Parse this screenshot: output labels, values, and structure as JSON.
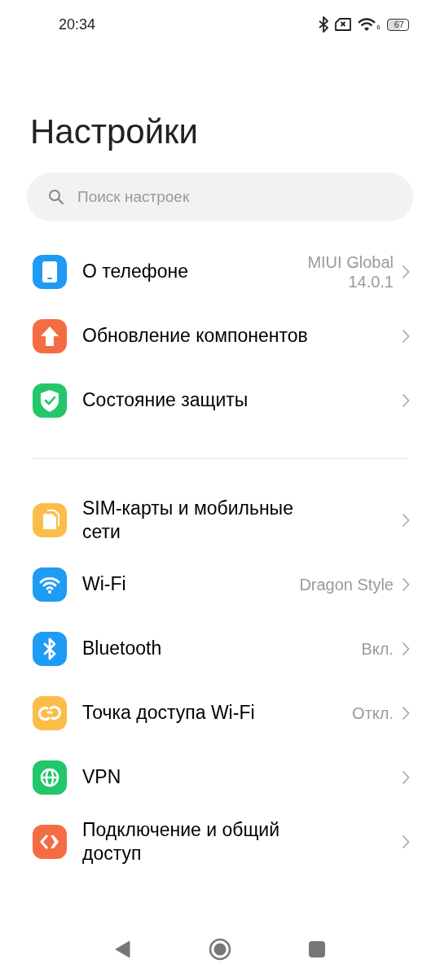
{
  "status_bar": {
    "time": "20:34",
    "wifi_badge": "6",
    "battery": "67"
  },
  "title": "Настройки",
  "search": {
    "placeholder": "Поиск настроек"
  },
  "groups": [
    {
      "items": [
        {
          "label": "О телефоне",
          "value": "MIUI Global 14.0.1",
          "color": "#1e9bf5"
        },
        {
          "label": "Обновление компонентов",
          "color": "#f56c42"
        },
        {
          "label": "Состояние защиты",
          "color": "#22c76a"
        }
      ]
    },
    {
      "items": [
        {
          "label": "SIM-карты и мобильные сети",
          "color": "#fbbd4a"
        },
        {
          "label": "Wi-Fi",
          "value": "Dragon Style",
          "color": "#1e9bf5"
        },
        {
          "label": "Bluetooth",
          "value": "Вкл.",
          "color": "#1e9bf5"
        },
        {
          "label": "Точка доступа Wi-Fi",
          "value": "Откл.",
          "color": "#fbbd4a"
        },
        {
          "label": "VPN",
          "color": "#22c76a"
        },
        {
          "label": "Подключение и общий доступ",
          "color": "#f56c42"
        }
      ]
    }
  ]
}
